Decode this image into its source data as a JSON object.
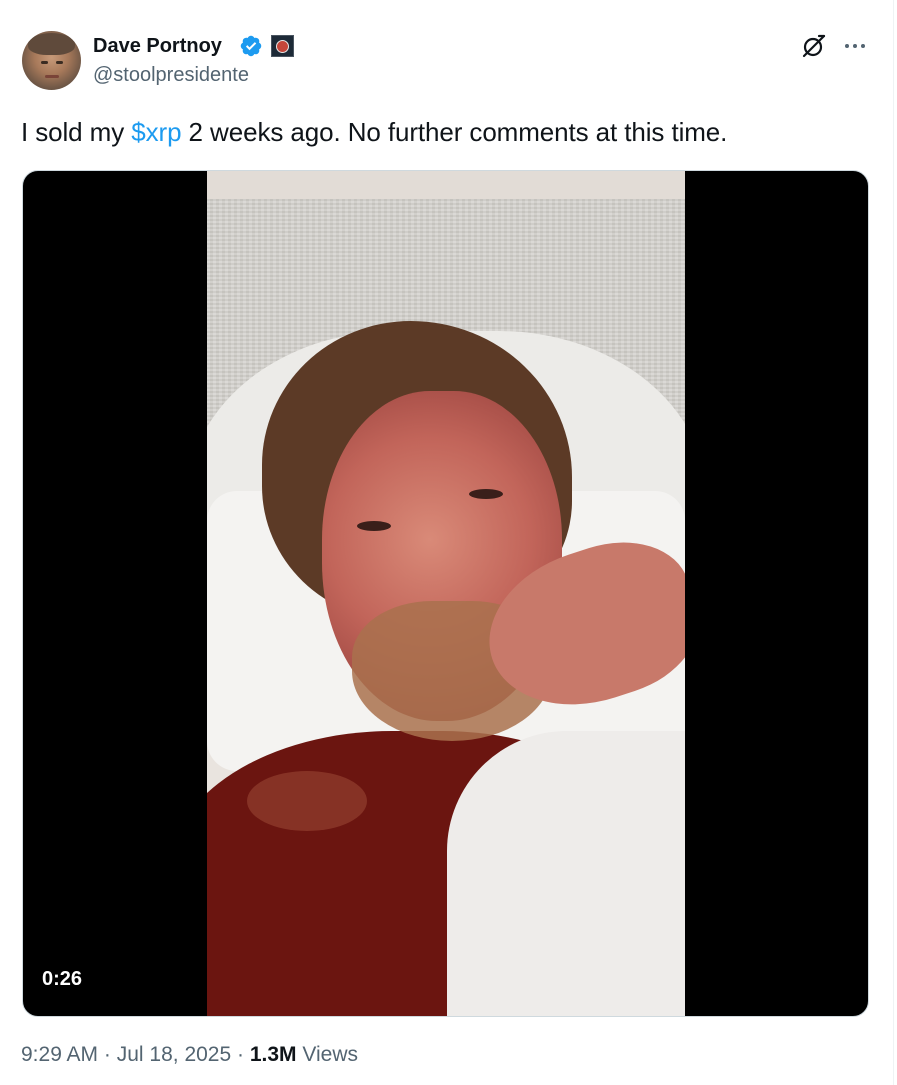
{
  "author": {
    "display_name": "Dave Portnoy",
    "handle": "@stoolpresidente",
    "verified_icon": "verified-badge-icon",
    "affiliate_badge_icon": "affiliate-badge-icon"
  },
  "header_actions": {
    "grok_icon": "grok-icon",
    "more_icon": "more-options-icon"
  },
  "tweet": {
    "text_before": "I sold my ",
    "cashtag": "$xrp",
    "text_after": " 2 weeks ago.  No further comments at this time."
  },
  "media": {
    "type": "video",
    "duration": "0:26"
  },
  "meta": {
    "time": "9:29 AM",
    "sep1": " · ",
    "date": "Jul 18, 2025",
    "sep2": " · ",
    "views_count": "1.3M",
    "views_label": " Views"
  },
  "colors": {
    "accent": "#1d9bf0",
    "text_primary": "#0f1419",
    "text_secondary": "#536471"
  }
}
